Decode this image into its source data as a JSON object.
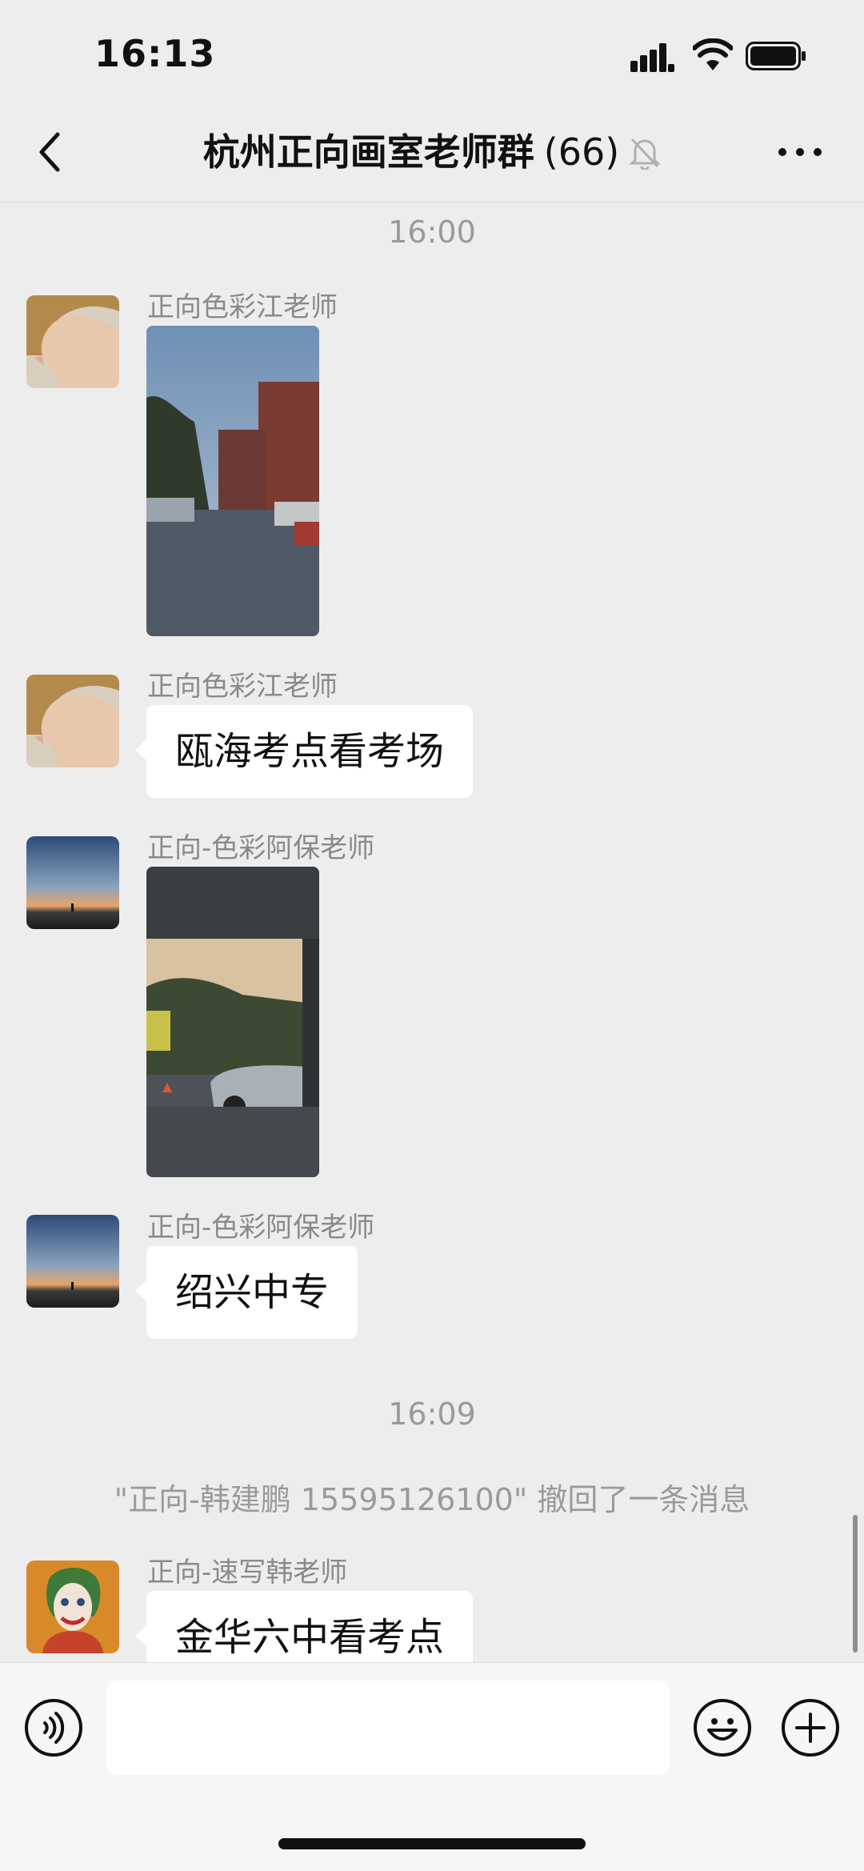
{
  "status_bar": {
    "time": "16:13"
  },
  "nav": {
    "title": "杭州正向画室老师群",
    "member_count": "(66)"
  },
  "chat": {
    "time_1": "16:00",
    "time_2": "16:09",
    "messages": [
      {
        "sender": "正向色彩江老师",
        "type": "image",
        "avatar": "portrait-avatar"
      },
      {
        "sender": "正向色彩江老师",
        "type": "text",
        "text": "瓯海考点看考场",
        "avatar": "portrait-avatar"
      },
      {
        "sender": "正向-色彩阿保老师",
        "type": "image",
        "avatar": "sunset-avatar"
      },
      {
        "sender": "正向-色彩阿保老师",
        "type": "text",
        "text": "绍兴中专",
        "avatar": "sunset-avatar"
      },
      {
        "sender": "正向-速写韩老师",
        "type": "text",
        "text": "金华六中看考点",
        "avatar": "joker-avatar"
      }
    ],
    "recall_notice": "\"正向-韩建鹏 15595126100\" 撤回了一条消息"
  },
  "input": {
    "placeholder": ""
  },
  "icons": [
    "back-icon",
    "mute-icon",
    "more-icon",
    "voice-icon",
    "emoji-icon",
    "plus-icon",
    "signal-icon",
    "wifi-icon",
    "battery-icon"
  ],
  "colors": {
    "background": "#ededed",
    "bubble": "#ffffff",
    "meta_text": "#9a9a9a"
  }
}
